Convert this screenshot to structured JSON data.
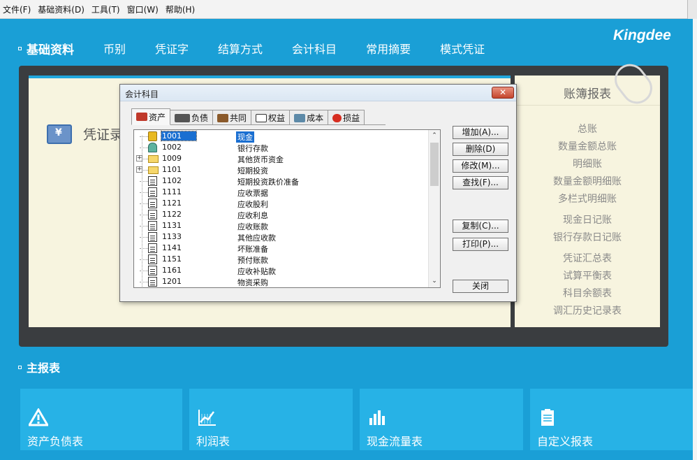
{
  "menubar": [
    "文件(F)",
    "基础资料(D)",
    "工具(T)",
    "窗口(W)",
    "帮助(H)"
  ],
  "brand": "Kingdee",
  "top_section": {
    "title": "基础资料",
    "links": [
      "币别",
      "凭证字",
      "结算方式",
      "会计科目",
      "常用摘要",
      "模式凭证"
    ]
  },
  "voucher": {
    "label": "凭证录",
    "icon_glyph": "¥"
  },
  "ledger": {
    "title": "账簿报表",
    "items": [
      "总账",
      "数量金额总账",
      "明细账",
      "数量金额明细账",
      "多栏式明细账",
      "现金日记账",
      "银行存款日记账",
      "凭证汇总表",
      "试算平衡表",
      "科目余额表",
      "调汇历史记录表"
    ]
  },
  "main_reports": {
    "title": "主报表",
    "tiles": [
      "资产负债表",
      "利润表",
      "现金流量表",
      "自定义报表"
    ]
  },
  "dialog": {
    "title": "会计科目",
    "close_glyph": "✕",
    "tabs": [
      "资产",
      "负债",
      "共同",
      "权益",
      "成本",
      "损益"
    ],
    "accounts": [
      {
        "code": "1001",
        "name": "现金"
      },
      {
        "code": "1002",
        "name": "银行存款"
      },
      {
        "code": "1009",
        "name": "其他货币资金"
      },
      {
        "code": "1101",
        "name": "短期投资"
      },
      {
        "code": "1102",
        "name": "短期投资跌价准备"
      },
      {
        "code": "1111",
        "name": "应收票据"
      },
      {
        "code": "1121",
        "name": "应收股利"
      },
      {
        "code": "1122",
        "name": "应收利息"
      },
      {
        "code": "1131",
        "name": "应收账款"
      },
      {
        "code": "1133",
        "name": "其他应收款"
      },
      {
        "code": "1141",
        "name": "坏账准备"
      },
      {
        "code": "1151",
        "name": "预付账款"
      },
      {
        "code": "1161",
        "name": "应收补贴款"
      },
      {
        "code": "1201",
        "name": "物资采购"
      }
    ],
    "buttons": {
      "add": "增加(A)...",
      "delete": "删除(D)",
      "modify": "修改(M)...",
      "find": "查找(F)...",
      "copy": "复制(C)...",
      "print": "打印(P)...",
      "close": "关闭"
    }
  },
  "colors": {
    "background": "#1a9fd6",
    "frame": "#3a3d40",
    "panel": "#f7f4df",
    "selection": "#1a6fd1"
  }
}
